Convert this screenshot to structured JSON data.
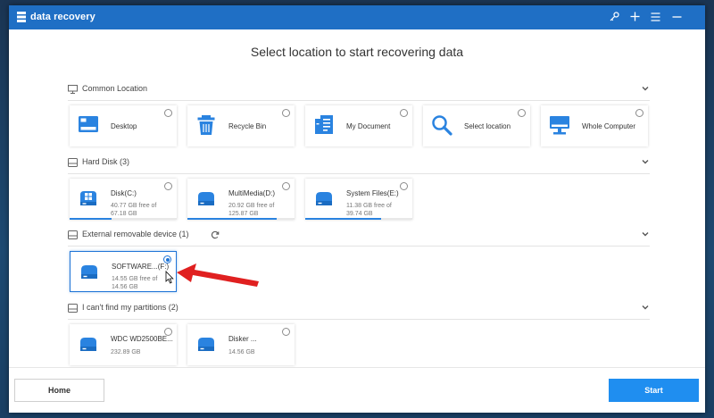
{
  "app": {
    "title": "data recovery",
    "brand_color": "#1f6fc5"
  },
  "titlebar_buttons": [
    {
      "name": "key-icon",
      "glyph": "⚷"
    },
    {
      "name": "plus-icon",
      "glyph": "+"
    },
    {
      "name": "menu-icon",
      "glyph": "≡"
    },
    {
      "name": "minimize-icon",
      "glyph": "—"
    }
  ],
  "headline": "Select location to start recovering data",
  "sections": {
    "common": {
      "title": "Common Location",
      "items": [
        {
          "label": "Desktop",
          "icon": "desktop-icon"
        },
        {
          "label": "Recycle Bin",
          "icon": "recycle-bin-icon"
        },
        {
          "label": "My Document",
          "icon": "document-icon"
        },
        {
          "label": "Select location",
          "icon": "magnifier-icon"
        },
        {
          "label": "Whole Computer",
          "icon": "computer-icon"
        }
      ]
    },
    "hard_disk": {
      "title": "Hard Disk (3)",
      "drives": [
        {
          "name": "Disk(C:)",
          "free": "40.77 GB  free of",
          "total": "67.18 GB",
          "used_fraction": 0.39
        },
        {
          "name": "MultiMedia(D:)",
          "free": "20.92 GB  free of",
          "total": "125.87 GB",
          "used_fraction": 0.83
        },
        {
          "name": "System Files(E:)",
          "free": "11.38 GB  free of",
          "total": "39.74 GB",
          "used_fraction": 0.71
        }
      ]
    },
    "external": {
      "title": "External removable device (1)",
      "drives": [
        {
          "name": "SOFTWARE...(F:)",
          "free": "14.55 GB  free of",
          "total": "14.56 GB",
          "used_fraction": 0.0,
          "selected": true
        }
      ]
    },
    "partitions": {
      "title": "I can't find my partitions (2)",
      "drives": [
        {
          "name": "WDC WD2500BE...",
          "size": "232.89 GB"
        },
        {
          "name": "Disker ...",
          "size": "14.56 GB"
        }
      ]
    }
  },
  "footer": {
    "home_label": "Home",
    "start_label": "Start",
    "start_color": "#1f8ef0"
  },
  "annotation_color": "#e02020"
}
